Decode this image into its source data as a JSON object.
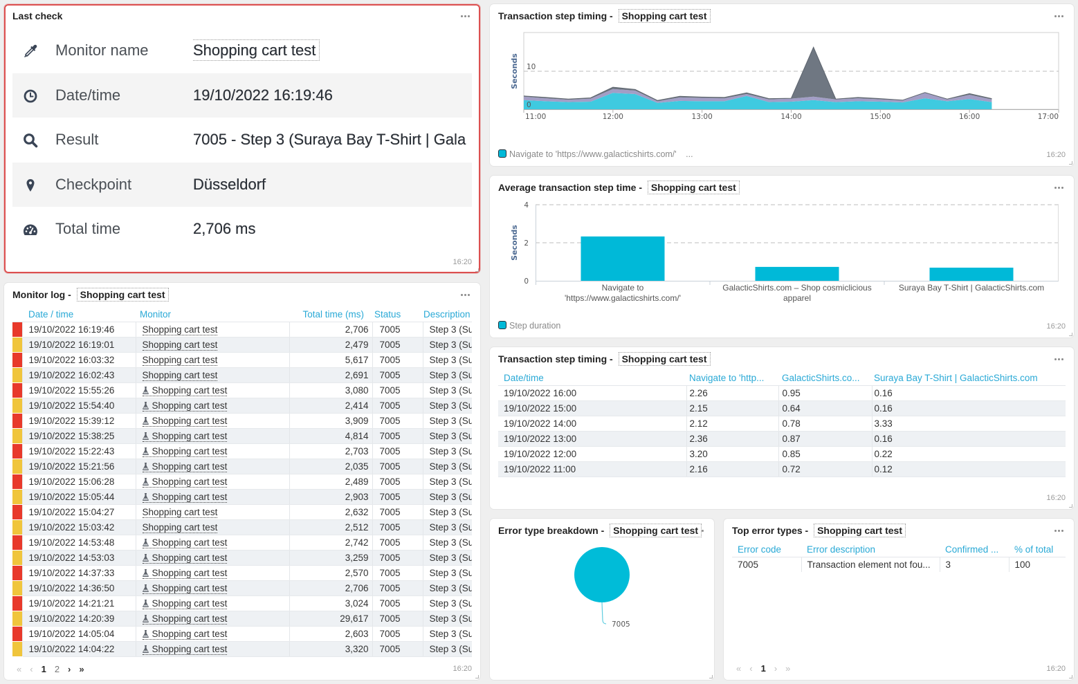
{
  "last_check": {
    "title": "Last check",
    "updated": "16:20",
    "rows": [
      {
        "icon": "eyedropper-icon",
        "label": "Monitor name",
        "value": "Shopping cart test"
      },
      {
        "icon": "clock-icon",
        "label": "Date/time",
        "value": "19/10/2022 16:19:46"
      },
      {
        "icon": "search-icon",
        "label": "Result",
        "value": "7005 - Step 3 (Suraya Bay T-Shirt | Gala"
      },
      {
        "icon": "map-marker-icon",
        "label": "Checkpoint",
        "value": "Düsseldorf"
      },
      {
        "icon": "tachometer-icon",
        "label": "Total time",
        "value": "2,706 ms"
      }
    ]
  },
  "monitor_log": {
    "title": "Monitor log - ",
    "monitor": "Shopping cart test",
    "updated": "16:20",
    "columns": [
      "Date / time",
      "Monitor",
      "Total time (ms)",
      "Status",
      "Description"
    ],
    "severity_colors": {
      "error": "#e8392b",
      "warning": "#f0c53c"
    },
    "rows": [
      {
        "time": "19/10/2022 16:19:46",
        "monitor": "Shopping cart test",
        "flask": false,
        "total": "2,706",
        "status": "7005",
        "description": "Step 3 (Su",
        "severity": "error"
      },
      {
        "time": "19/10/2022 16:19:01",
        "monitor": "Shopping cart test",
        "flask": false,
        "total": "2,479",
        "status": "7005",
        "description": "Step 3 (Su",
        "severity": "warning"
      },
      {
        "time": "19/10/2022 16:03:32",
        "monitor": "Shopping cart test",
        "flask": false,
        "total": "5,617",
        "status": "7005",
        "description": "Step 3 (Su",
        "severity": "error"
      },
      {
        "time": "19/10/2022 16:02:43",
        "monitor": "Shopping cart test",
        "flask": false,
        "total": "2,691",
        "status": "7005",
        "description": "Step 3 (Su",
        "severity": "warning"
      },
      {
        "time": "19/10/2022 15:55:26",
        "monitor": "Shopping cart test",
        "flask": true,
        "total": "3,080",
        "status": "7005",
        "description": "Step 3 (Su",
        "severity": "error"
      },
      {
        "time": "19/10/2022 15:54:40",
        "monitor": "Shopping cart test",
        "flask": true,
        "total": "2,414",
        "status": "7005",
        "description": "Step 3 (Su",
        "severity": "warning"
      },
      {
        "time": "19/10/2022 15:39:12",
        "monitor": "Shopping cart test",
        "flask": true,
        "total": "3,909",
        "status": "7005",
        "description": "Step 3 (Su",
        "severity": "error"
      },
      {
        "time": "19/10/2022 15:38:25",
        "monitor": "Shopping cart test",
        "flask": true,
        "total": "4,814",
        "status": "7005",
        "description": "Step 3 (Su",
        "severity": "warning"
      },
      {
        "time": "19/10/2022 15:22:43",
        "monitor": "Shopping cart test",
        "flask": true,
        "total": "2,703",
        "status": "7005",
        "description": "Step 3 (Su",
        "severity": "error"
      },
      {
        "time": "19/10/2022 15:21:56",
        "monitor": "Shopping cart test",
        "flask": true,
        "total": "2,035",
        "status": "7005",
        "description": "Step 3 (Su",
        "severity": "warning"
      },
      {
        "time": "19/10/2022 15:06:28",
        "monitor": "Shopping cart test",
        "flask": true,
        "total": "2,489",
        "status": "7005",
        "description": "Step 3 (Su",
        "severity": "error"
      },
      {
        "time": "19/10/2022 15:05:44",
        "monitor": "Shopping cart test",
        "flask": true,
        "total": "2,903",
        "status": "7005",
        "description": "Step 3 (Su",
        "severity": "warning"
      },
      {
        "time": "19/10/2022 15:04:27",
        "monitor": "Shopping cart test",
        "flask": false,
        "total": "2,632",
        "status": "7005",
        "description": "Step 3 (Su",
        "severity": "error"
      },
      {
        "time": "19/10/2022 15:03:42",
        "monitor": "Shopping cart test",
        "flask": false,
        "total": "2,512",
        "status": "7005",
        "description": "Step 3 (Su",
        "severity": "warning"
      },
      {
        "time": "19/10/2022 14:53:48",
        "monitor": "Shopping cart test",
        "flask": true,
        "total": "2,742",
        "status": "7005",
        "description": "Step 3 (Su",
        "severity": "error"
      },
      {
        "time": "19/10/2022 14:53:03",
        "monitor": "Shopping cart test",
        "flask": true,
        "total": "3,259",
        "status": "7005",
        "description": "Step 3 (Su",
        "severity": "warning"
      },
      {
        "time": "19/10/2022 14:37:33",
        "monitor": "Shopping cart test",
        "flask": true,
        "total": "2,570",
        "status": "7005",
        "description": "Step 3 (Su",
        "severity": "error"
      },
      {
        "time": "19/10/2022 14:36:50",
        "monitor": "Shopping cart test",
        "flask": true,
        "total": "2,706",
        "status": "7005",
        "description": "Step 3 (Su",
        "severity": "warning"
      },
      {
        "time": "19/10/2022 14:21:21",
        "monitor": "Shopping cart test",
        "flask": true,
        "total": "3,024",
        "status": "7005",
        "description": "Step 3 (Su",
        "severity": "error"
      },
      {
        "time": "19/10/2022 14:20:39",
        "monitor": "Shopping cart test",
        "flask": true,
        "total": "29,617",
        "status": "7005",
        "description": "Step 3 (Su",
        "severity": "warning"
      },
      {
        "time": "19/10/2022 14:05:04",
        "monitor": "Shopping cart test",
        "flask": true,
        "total": "2,603",
        "status": "7005",
        "description": "Step 3 (Su",
        "severity": "error"
      },
      {
        "time": "19/10/2022 14:04:22",
        "monitor": "Shopping cart test",
        "flask": true,
        "total": "3,320",
        "status": "7005",
        "description": "Step 3 (Su",
        "severity": "warning"
      }
    ],
    "pagination": {
      "first": "«",
      "prev": "‹",
      "pages": [
        "1",
        "2"
      ],
      "current": "1",
      "next": "›",
      "last": "»"
    }
  },
  "timing_chart_panel": {
    "title": "Transaction step timing - ",
    "monitor": "Shopping cart test",
    "legend_text": "Navigate to 'https://www.galacticshirts.com/'",
    "legend_more": "...",
    "updated": "16:20"
  },
  "avg_chart_panel": {
    "title": "Average transaction step time - ",
    "monitor": "Shopping cart test",
    "legend_text": "Step duration",
    "updated": "16:20"
  },
  "timing_table": {
    "title": "Transaction step timing - ",
    "monitor": "Shopping cart test",
    "updated": "16:20",
    "columns": [
      "Date/time",
      "Navigate to 'http...",
      "GalacticShirts.co...",
      "Suraya Bay T-Shirt | GalacticShirts.com"
    ],
    "rows": [
      [
        "19/10/2022 16:00",
        "2.26",
        "0.95",
        "0.16"
      ],
      [
        "19/10/2022 15:00",
        "2.15",
        "0.64",
        "0.16"
      ],
      [
        "19/10/2022 14:00",
        "2.12",
        "0.78",
        "3.33"
      ],
      [
        "19/10/2022 13:00",
        "2.36",
        "0.87",
        "0.16"
      ],
      [
        "19/10/2022 12:00",
        "3.20",
        "0.85",
        "0.22"
      ],
      [
        "19/10/2022 11:00",
        "2.16",
        "0.72",
        "0.12"
      ]
    ]
  },
  "error_breakdown_panel": {
    "title": "Error type breakdown - ",
    "monitor": "Shopping cart test"
  },
  "top_errors": {
    "title": "Top error types - ",
    "monitor": "Shopping cart test",
    "updated": "16:20",
    "columns": [
      "Error code",
      "Error description",
      "Confirmed ...",
      "% of total"
    ],
    "rows": [
      [
        "7005",
        "Transaction element not fou...",
        "3",
        "100"
      ]
    ],
    "pagination": {
      "first": "«",
      "prev": "‹",
      "pages": [
        "1"
      ],
      "current": "1",
      "next": "›",
      "last": "»"
    }
  },
  "chart_data": [
    {
      "type": "area",
      "stacked": true,
      "title": "Transaction step timing - Shopping cart test",
      "xlabel": "",
      "ylabel": "Seconds",
      "xlim": [
        "11:00",
        "17:00"
      ],
      "ylim": [
        0,
        20
      ],
      "x_ticks": [
        "11:00",
        "12:00",
        "13:00",
        "14:00",
        "15:00",
        "16:00",
        "17:00"
      ],
      "y_ticks": [
        "0",
        "10"
      ],
      "grid": "dashed horizontal at 10",
      "legend": "bottom-left",
      "x": [
        "11:00",
        "11:15",
        "11:30",
        "11:45",
        "12:00",
        "12:15",
        "12:30",
        "12:45",
        "13:00",
        "13:15",
        "13:30",
        "13:45",
        "14:00",
        "14:15",
        "14:30",
        "14:45",
        "15:00",
        "15:15",
        "15:30",
        "15:45",
        "16:00",
        "16:15"
      ],
      "series": [
        {
          "name": "Navigate to 'https://www.galacticshirts.com/'",
          "color": "#3fcae0",
          "values": [
            2.4,
            2.1,
            1.9,
            2.0,
            4.3,
            4.0,
            1.7,
            2.2,
            2.1,
            2.1,
            3.5,
            1.9,
            2.0,
            2.4,
            1.9,
            2.1,
            2.0,
            1.8,
            2.9,
            2.1,
            2.7,
            1.9
          ]
        },
        {
          "name": "GalacticShirts.com – Shop cosmiclicious apparel",
          "color": "#a29ec6",
          "values": [
            0.9,
            0.8,
            0.6,
            0.8,
            1.0,
            0.9,
            0.4,
            0.9,
            0.9,
            0.8,
            0.5,
            0.7,
            0.8,
            0.9,
            0.7,
            0.8,
            0.6,
            0.5,
            1.4,
            0.5,
            1.1,
            0.7
          ]
        },
        {
          "name": "Suraya Bay T-Shirt | GalacticShirts.com",
          "color": "#6f7782",
          "values": [
            0.2,
            0.2,
            0.2,
            0.2,
            0.5,
            0.3,
            0.2,
            0.3,
            0.2,
            0.2,
            0.3,
            0.2,
            0.1,
            13.0,
            0.1,
            0.2,
            0.2,
            0.1,
            0.1,
            0.1,
            0.3,
            0.2
          ]
        }
      ]
    },
    {
      "type": "bar",
      "title": "Average transaction step time - Shopping cart test",
      "xlabel": "",
      "ylabel": "Seconds",
      "ylim": [
        0,
        4
      ],
      "y_ticks": [
        "0",
        "2",
        "4"
      ],
      "grid": "dashed horizontal",
      "legend": "bottom-left",
      "categories": [
        "Navigate to 'https://www.galacticshirts.com/'",
        "GalacticShirts.com – Shop cosmiclicious apparel",
        "Suraya Bay T-Shirt | GalacticShirts.com"
      ],
      "category_lines": [
        [
          "Navigate to",
          "'https://www.galacticshirts.com/'"
        ],
        [
          "GalacticShirts.com – Shop cosmiclicious",
          "apparel"
        ],
        [
          "Suraya Bay T-Shirt | GalacticShirts.com"
        ]
      ],
      "series": [
        {
          "name": "Step duration",
          "color": "#00b9d8",
          "values": [
            2.33,
            0.73,
            0.69
          ]
        }
      ]
    },
    {
      "type": "pie",
      "title": "Error type breakdown - Shopping cart test",
      "slices": [
        {
          "label": "7005",
          "value": 100,
          "color": "#00bcd8"
        }
      ]
    }
  ]
}
